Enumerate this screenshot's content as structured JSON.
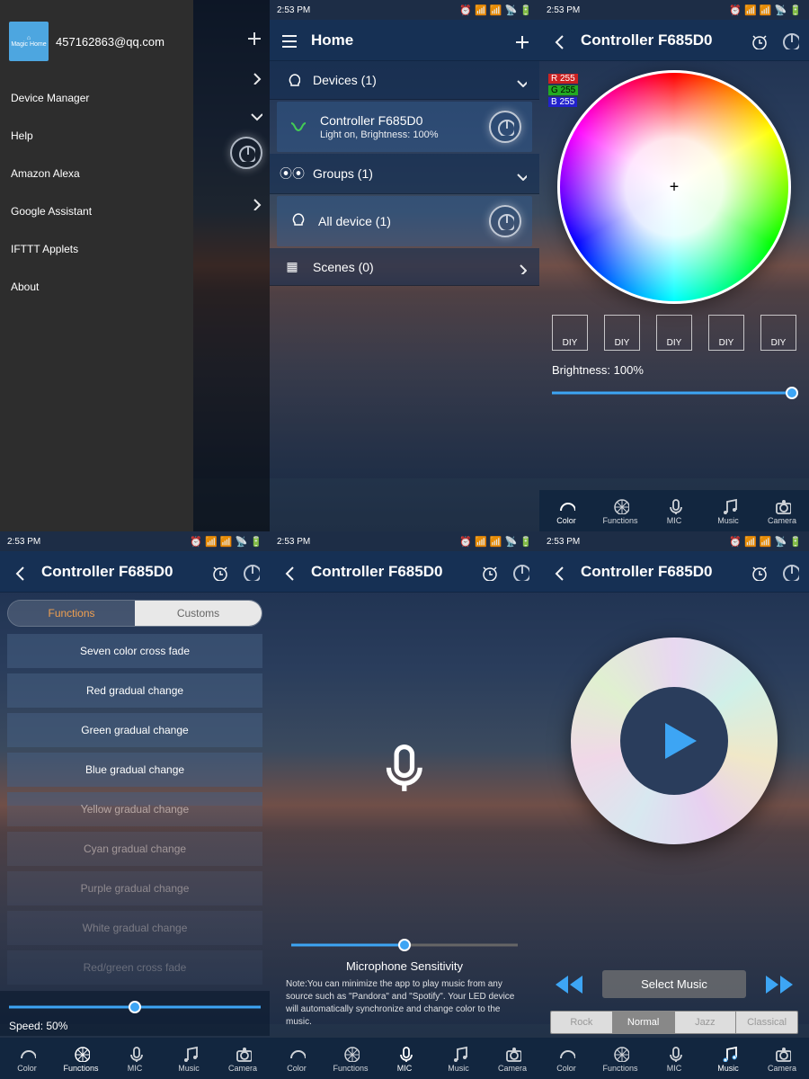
{
  "status_time": "2:53 PM",
  "controller_title": "Controller  F685D0",
  "drawer": {
    "email": "457162863@qq.com",
    "brand": "Magic Home",
    "items": [
      "Device Manager",
      "Help",
      "Amazon Alexa",
      "Google Assistant",
      "IFTTT Applets",
      "About"
    ]
  },
  "home": {
    "title": "Home",
    "devices_header": "Devices (1)",
    "device_name": "Controller  F685D0",
    "device_status": "Light on, Brightness: 100%",
    "groups_header": "Groups (1)",
    "group_name": "All device (1)",
    "scenes_header": "Scenes (0)"
  },
  "color": {
    "r_label": "R 255",
    "g_label": "G 255",
    "b_label": "B 255",
    "diy": [
      "DIY",
      "DIY",
      "DIY",
      "DIY",
      "DIY"
    ],
    "brightness_label": "Brightness: 100%"
  },
  "functions": {
    "tab_functions": "Functions",
    "tab_customs": "Customs",
    "list": [
      "Seven color cross fade",
      "Red gradual change",
      "Green gradual change",
      "Blue gradual change",
      "Yellow gradual change",
      "Cyan gradual change",
      "Purple gradual change",
      "White gradual change",
      "Red/green cross fade"
    ],
    "speed_label": "Speed: 50%"
  },
  "mic": {
    "sensitivity_label": "Microphone Sensitivity",
    "note": "Note:You can minimize the app to play music from any source such as \"Pandora\" and \"Spotify\". Your LED device will automatically synchronize and change color to the music."
  },
  "music": {
    "select_label": "Select Music",
    "genres": [
      "Rock",
      "Normal",
      "Jazz",
      "Classical"
    ]
  },
  "nav": {
    "color": "Color",
    "functions": "Functions",
    "mic": "MIC",
    "music": "Music",
    "camera": "Camera"
  }
}
